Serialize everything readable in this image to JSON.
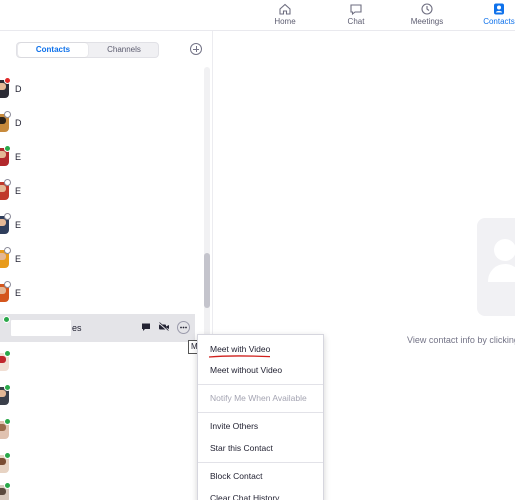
{
  "topnav": {
    "items": [
      {
        "label": "Home",
        "icon": "home-icon"
      },
      {
        "label": "Chat",
        "icon": "chat-icon"
      },
      {
        "label": "Meetings",
        "icon": "clock-icon"
      },
      {
        "label": "Contacts",
        "icon": "contacts-icon",
        "active": true
      }
    ],
    "accent": "#0e71eb"
  },
  "sidebar": {
    "tabs": [
      {
        "label": "Contacts",
        "active": true
      },
      {
        "label": "Channels",
        "active": false
      }
    ],
    "contacts": [
      {
        "initial": "D",
        "presence": "red"
      },
      {
        "initial": "D",
        "presence": "offline"
      },
      {
        "initial": "E",
        "presence": "green"
      },
      {
        "initial": "E",
        "presence": "offline"
      },
      {
        "initial": "E",
        "presence": "offline"
      },
      {
        "initial": "E",
        "presence": "offline"
      },
      {
        "initial": "E",
        "presence": "offline"
      }
    ],
    "hovered_contact": {
      "name_suffix": "es",
      "presence": "green"
    },
    "lower_contacts": [
      {
        "presence": "green"
      },
      {
        "presence": "green"
      },
      {
        "presence": "green"
      },
      {
        "presence": "green"
      },
      {
        "presence": "green"
      }
    ],
    "tooltip_text": "M"
  },
  "main": {
    "empty_hint": "View contact info by clicking"
  },
  "context_menu": {
    "items": [
      {
        "label": "Meet with Video",
        "enabled": true
      },
      {
        "label": "Meet without Video",
        "enabled": true
      },
      {
        "label": "Notify Me When Available",
        "enabled": false
      },
      {
        "label": "Invite Others",
        "enabled": true
      },
      {
        "label": "Star this Contact",
        "enabled": true
      },
      {
        "label": "Block Contact",
        "enabled": true
      },
      {
        "label": "Clear Chat History",
        "enabled": true
      }
    ],
    "annotation_color": "#d0201c"
  }
}
